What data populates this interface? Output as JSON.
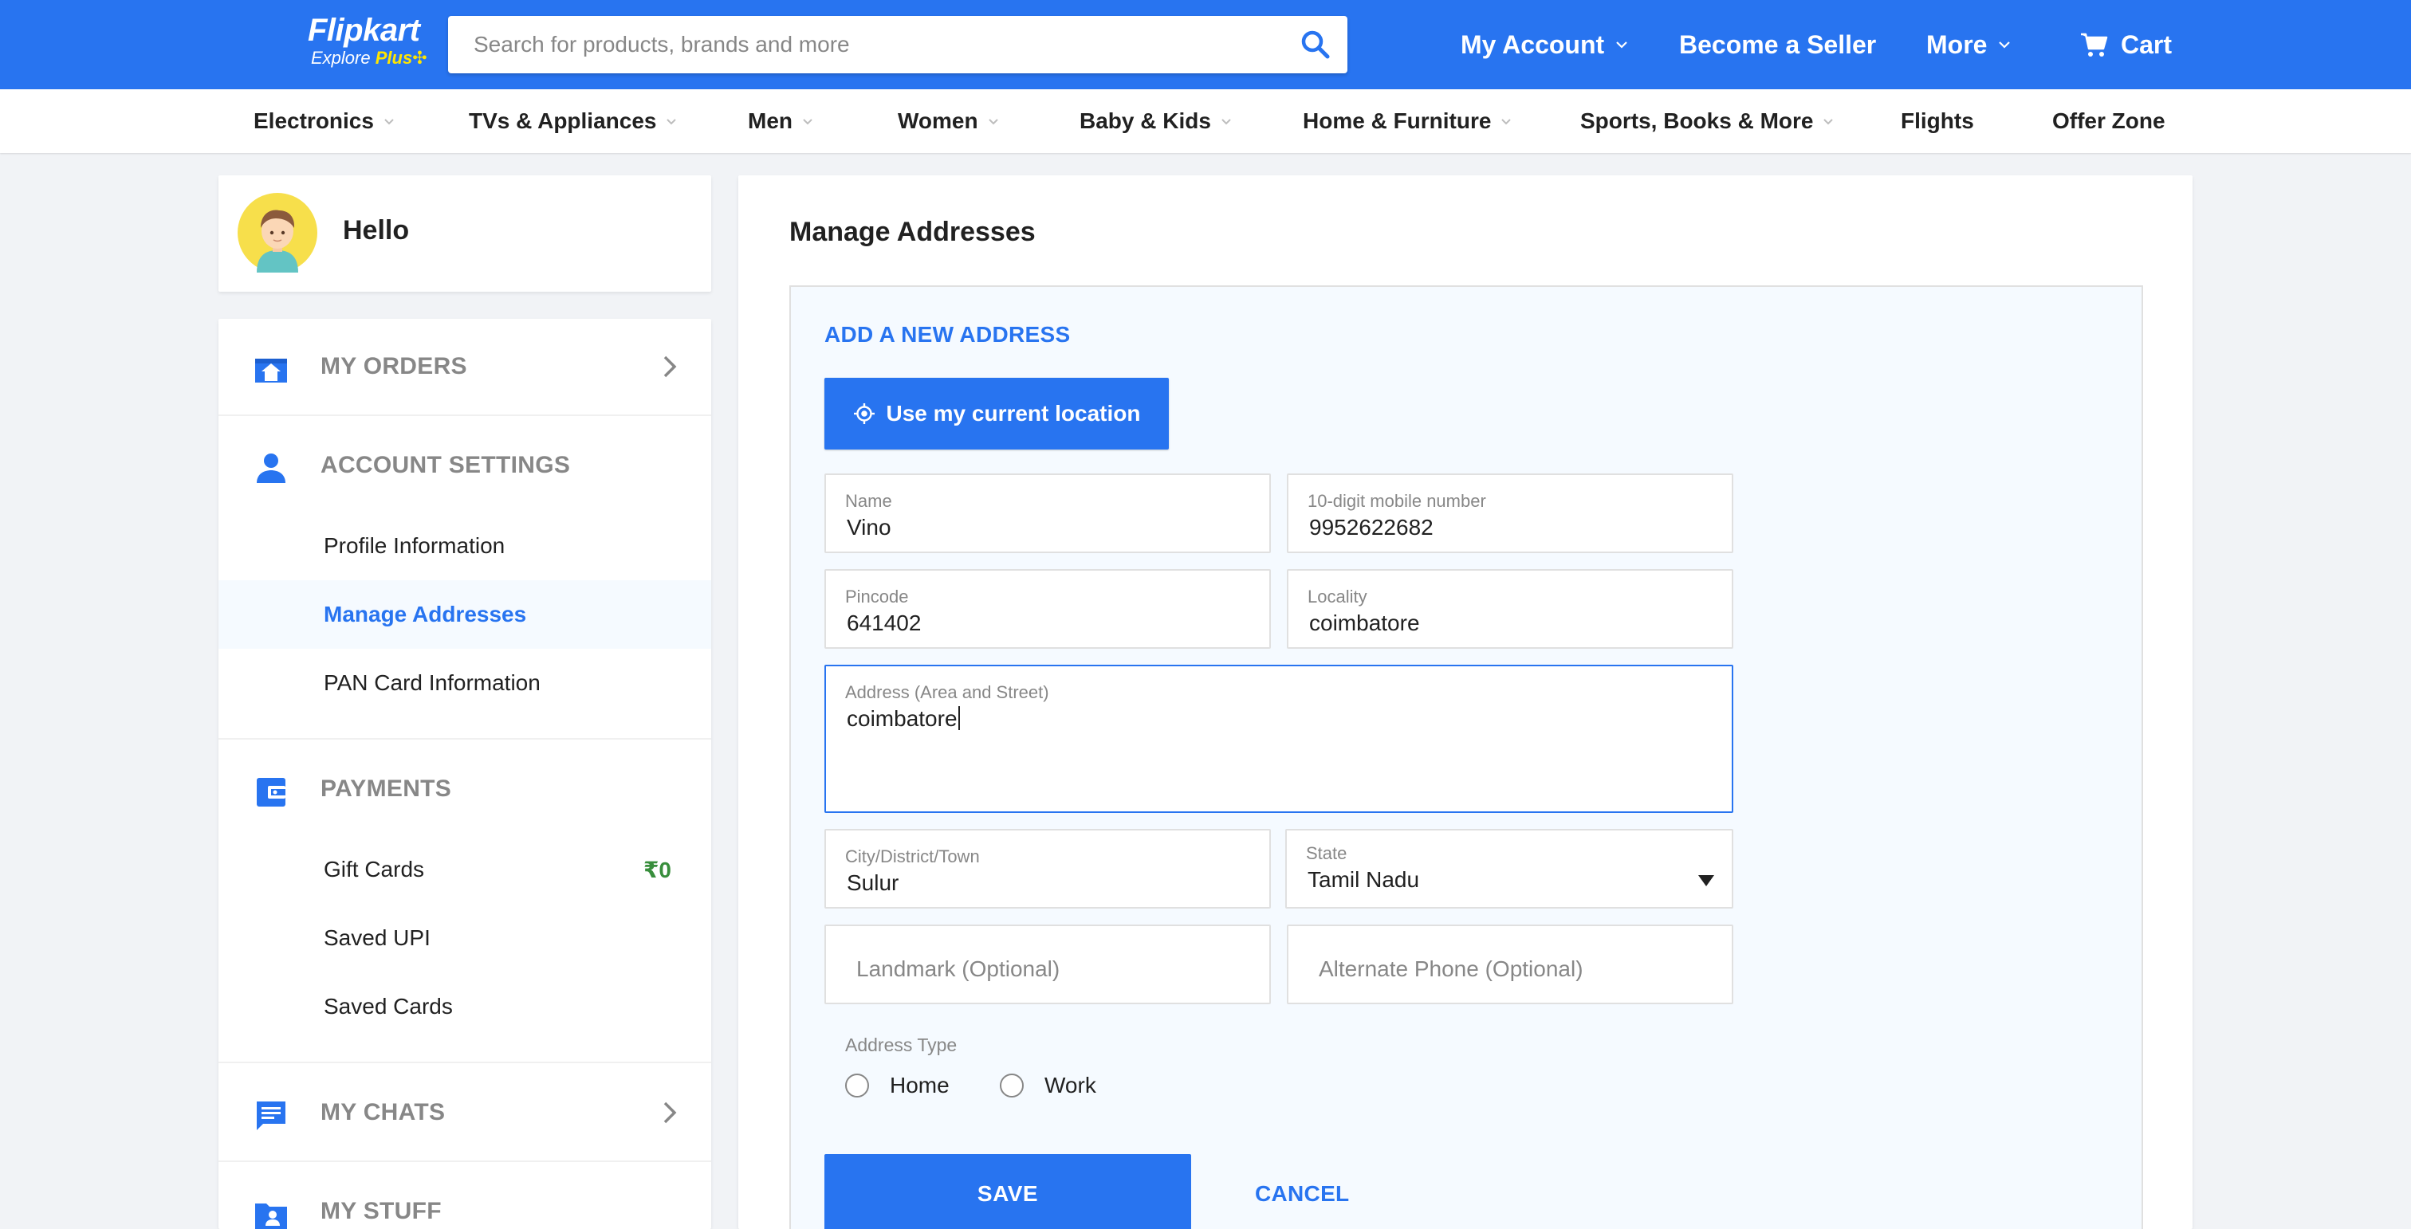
{
  "header": {
    "logo_brand": "Flipkart",
    "logo_tag_prefix": "Explore",
    "logo_tag_plus": "Plus",
    "search_placeholder": "Search for products, brands and more",
    "my_account": "My Account",
    "become_seller": "Become a Seller",
    "more": "More",
    "cart": "Cart",
    "brand_color": "#2874f0"
  },
  "categories": [
    "Electronics",
    "TVs & Appliances",
    "Men",
    "Women",
    "Baby & Kids",
    "Home & Furniture",
    "Sports, Books & More",
    "Flights",
    "Offer Zone"
  ],
  "sidebar": {
    "greeting": "Hello",
    "my_orders": "MY ORDERS",
    "account_settings": "ACCOUNT SETTINGS",
    "profile_info": "Profile Information",
    "manage_addresses": "Manage Addresses",
    "pan_card": "PAN Card Information",
    "payments": "PAYMENTS",
    "gift_cards": "Gift Cards",
    "gift_cards_amount": "₹0",
    "saved_upi": "Saved UPI",
    "saved_cards": "Saved Cards",
    "my_chats": "MY CHATS",
    "my_stuff": "MY STUFF"
  },
  "main": {
    "title": "Manage Addresses",
    "add_new": "ADD A NEW ADDRESS",
    "use_location": "Use my current location",
    "name_label": "Name",
    "name_value": "Vino",
    "mobile_label": "10-digit mobile number",
    "mobile_value": "9952622682",
    "pincode_label": "Pincode",
    "pincode_value": "641402",
    "locality_label": "Locality",
    "locality_value": "coimbatore",
    "address_label": "Address (Area and Street)",
    "address_value": "coimbatore",
    "city_label": "City/District/Town",
    "city_value": "Sulur",
    "state_label": "State",
    "state_value": "Tamil Nadu",
    "landmark_placeholder": "Landmark (Optional)",
    "alt_phone_placeholder": "Alternate Phone (Optional)",
    "address_type_label": "Address Type",
    "type_home": "Home",
    "type_work": "Work",
    "save": "SAVE",
    "cancel": "CANCEL"
  }
}
